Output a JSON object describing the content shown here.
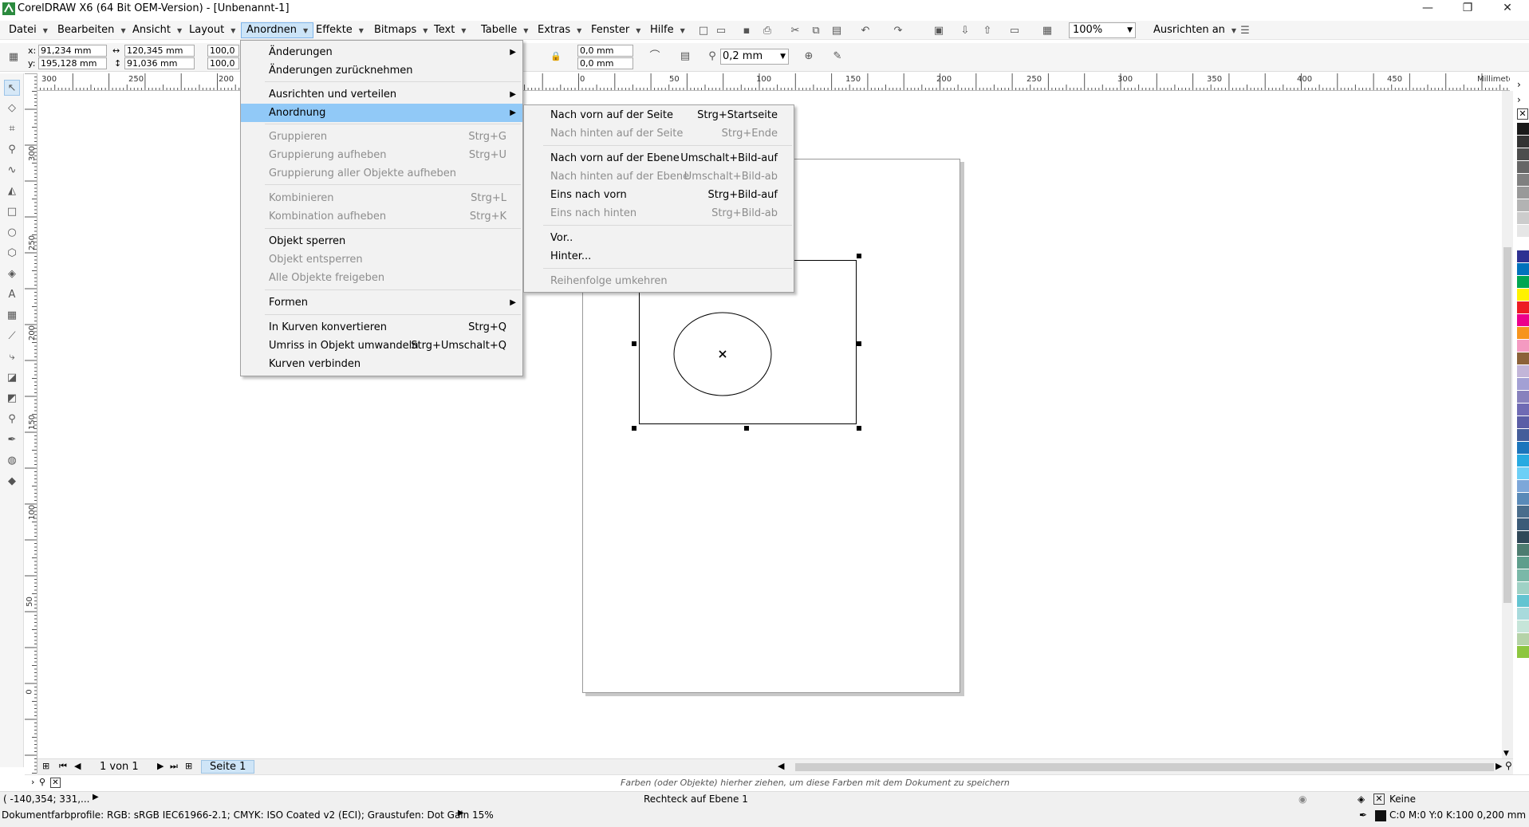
{
  "window": {
    "title": "CorelDRAW X6 (64 Bit OEM-Version) - [Unbenannt-1]",
    "minimize": "—",
    "restore": "❐",
    "close": "✕"
  },
  "menubar": {
    "items": [
      {
        "label": "Datei"
      },
      {
        "label": "Bearbeiten"
      },
      {
        "label": "Ansicht"
      },
      {
        "label": "Layout"
      },
      {
        "label": "Anordnen"
      },
      {
        "label": "Effekte"
      },
      {
        "label": "Bitmaps"
      },
      {
        "label": "Text"
      },
      {
        "label": "Tabelle"
      },
      {
        "label": "Extras"
      },
      {
        "label": "Fenster"
      },
      {
        "label": "Hilfe"
      }
    ],
    "active_item": "Anordnen",
    "zoom": "100%",
    "snap_label": "Ausrichten an"
  },
  "propbar": {
    "x_label": "x:",
    "x_value": "91,234 mm",
    "y_label": "y:",
    "y_value": "195,128 mm",
    "w_value": "120,345 mm",
    "h_value": "91,036 mm",
    "scale_w": "100,0",
    "scale_h": "100,0",
    "corner_1": "0,0 mm",
    "corner_2": "0,0 mm",
    "outline_width": "0,2 mm"
  },
  "rulers": {
    "unit": "Millimeter",
    "h_labels": [
      "300",
      "250",
      "200",
      "0",
      "50",
      "100",
      "150",
      "200",
      "250",
      "300",
      "350",
      "400",
      "450"
    ],
    "v_labels": [
      "300",
      "250",
      "200",
      "150",
      "100",
      "50",
      "0"
    ]
  },
  "arrange_menu": {
    "items": [
      {
        "label": "Änderungen",
        "shortcut": "",
        "disabled": false,
        "submenu": true
      },
      {
        "label": "Änderungen zurücknehmen",
        "shortcut": "",
        "disabled": false,
        "submenu": false
      },
      {
        "label": "Ausrichten und verteilen",
        "shortcut": "",
        "disabled": false,
        "submenu": true
      },
      {
        "label": "Anordnung",
        "shortcut": "",
        "disabled": false,
        "submenu": true
      },
      {
        "label": "Gruppieren",
        "shortcut": "Strg+G",
        "disabled": true,
        "submenu": false
      },
      {
        "label": "Gruppierung aufheben",
        "shortcut": "Strg+U",
        "disabled": true,
        "submenu": false
      },
      {
        "label": "Gruppierung aller Objekte aufheben",
        "shortcut": "",
        "disabled": true,
        "submenu": false
      },
      {
        "label": "Kombinieren",
        "shortcut": "Strg+L",
        "disabled": true,
        "submenu": false
      },
      {
        "label": "Kombination aufheben",
        "shortcut": "Strg+K",
        "disabled": true,
        "submenu": false
      },
      {
        "label": "Objekt sperren",
        "shortcut": "",
        "disabled": false,
        "submenu": false
      },
      {
        "label": "Objekt entsperren",
        "shortcut": "",
        "disabled": true,
        "submenu": false
      },
      {
        "label": "Alle Objekte freigeben",
        "shortcut": "",
        "disabled": true,
        "submenu": false
      },
      {
        "label": "Formen",
        "shortcut": "",
        "disabled": false,
        "submenu": true
      },
      {
        "label": "In Kurven konvertieren",
        "shortcut": "Strg+Q",
        "disabled": false,
        "submenu": false
      },
      {
        "label": "Umriss in Objekt umwandeln",
        "shortcut": "Strg+Umschalt+Q",
        "disabled": false,
        "submenu": false
      },
      {
        "label": "Kurven verbinden",
        "shortcut": "",
        "disabled": false,
        "submenu": false
      }
    ]
  },
  "order_submenu": {
    "items": [
      {
        "label": "Nach vorn auf der Seite",
        "shortcut": "Strg+Startseite",
        "disabled": false
      },
      {
        "label": "Nach hinten auf der Seite",
        "shortcut": "Strg+Ende",
        "disabled": true
      },
      {
        "label": "Nach vorn auf der Ebene",
        "shortcut": "Umschalt+Bild-auf",
        "disabled": false
      },
      {
        "label": "Nach hinten auf der Ebene",
        "shortcut": "Umschalt+Bild-ab",
        "disabled": true
      },
      {
        "label": "Eins nach vorn",
        "shortcut": "Strg+Bild-auf",
        "disabled": false
      },
      {
        "label": "Eins nach hinten",
        "shortcut": "Strg+Bild-ab",
        "disabled": true
      },
      {
        "label": "Vor..",
        "shortcut": "",
        "disabled": false
      },
      {
        "label": "Hinter...",
        "shortcut": "",
        "disabled": false
      },
      {
        "label": "Reihenfolge umkehren",
        "shortcut": "",
        "disabled": true
      }
    ]
  },
  "pagebar": {
    "page_count": "1 von 1",
    "page_tab": "Seite 1"
  },
  "docbar": {
    "hint": "Farben (oder Objekte) hierher ziehen, um diese Farben mit dem Dokument zu speichern"
  },
  "status": {
    "coords": "( -140,354; 331,...",
    "object_info": "Rechteck auf Ebene 1",
    "fill_label": "Keine",
    "color_profile": "Dokumentfarbprofile: RGB: sRGB IEC61966-2.1; CMYK: ISO Coated v2 (ECI); Graustufen: Dot Gain 15%",
    "outline_info": "C:0 M:0 Y:0 K:100  0,200 mm"
  },
  "palette": {
    "colors": [
      "#1a1a1a",
      "#333333",
      "#4d4d4d",
      "#666666",
      "#808080",
      "#999999",
      "#b3b3b3",
      "#cccccc",
      "#e6e6e6",
      "#ffffff",
      "#2e3192",
      "#0072bc",
      "#00a651",
      "#fff200",
      "#ed1c24",
      "#ec008c",
      "#f7941d",
      "#f49ac1",
      "#8c6239",
      "#c2b5d8",
      "#a3a0d4",
      "#8781bd",
      "#6f6bb4",
      "#5b5ea6",
      "#445d9a",
      "#1b75bc",
      "#27aae1",
      "#6dcff6",
      "#7da7d9",
      "#5a8ab8",
      "#4a6d8c",
      "#3b5b78",
      "#2f4858",
      "#4d7c70",
      "#5e9e8c",
      "#7ab8a8",
      "#9fd1c5",
      "#63c4d1",
      "#a8dadc",
      "#c6e5d9",
      "#b5d3a8",
      "#8dc63f"
    ]
  }
}
